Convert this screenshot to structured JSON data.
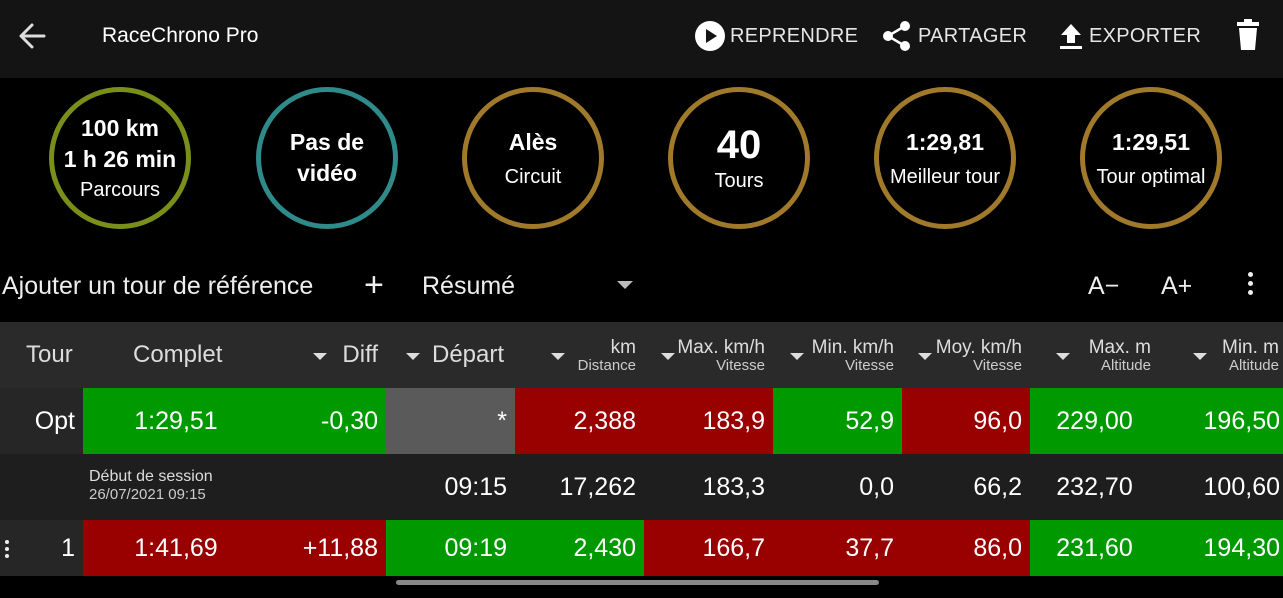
{
  "app_title": "RaceChrono Pro",
  "toolbar": {
    "resume_label": "REPRENDRE",
    "share_label": "PARTAGER",
    "export_label": "EXPORTER"
  },
  "stats": [
    {
      "value": "100 km\n1 h 26 min",
      "label": "Parcours",
      "color": "#7a8f1a"
    },
    {
      "value": "Pas de\nvidéo",
      "label": "",
      "color": "#2f8a8a"
    },
    {
      "value": "Alès",
      "label": "Circuit",
      "color": "#a07a2a"
    },
    {
      "value": "40",
      "label": "Tours",
      "color": "#a07a2a"
    },
    {
      "value": "1:29,81",
      "label": "Meilleur tour",
      "color": "#a07a2a"
    },
    {
      "value": "1:29,51",
      "label": "Tour optimal",
      "color": "#a07a2a"
    }
  ],
  "controls": {
    "add_reference_label": "Ajouter un tour de référence",
    "add_icon": "+",
    "view_select": "Résumé",
    "font_decrease": "A−",
    "font_increase": "A+"
  },
  "table": {
    "headers": {
      "tour": "Tour",
      "complet": "Complet",
      "diff": "Diff",
      "depart": "Départ",
      "km": {
        "title": "km",
        "sub": "Distance"
      },
      "maxkmh": {
        "title": "Max. km/h",
        "sub": "Vitesse"
      },
      "minkmh": {
        "title": "Min. km/h",
        "sub": "Vitesse"
      },
      "moykmh": {
        "title": "Moy. km/h",
        "sub": "Vitesse"
      },
      "maxm": {
        "title": "Max. m",
        "sub": "Altitude"
      },
      "minm": {
        "title": "Min. m",
        "sub": "Altitude"
      }
    },
    "opt_row": {
      "tour": "Opt",
      "complet": "1:29,51",
      "diff": "-0,30",
      "depart": "*",
      "km": "2,388",
      "maxkmh": "183,9",
      "minkmh": "52,9",
      "moykmh": "96,0",
      "maxm": "229,00",
      "minm": "196,50"
    },
    "session_row": {
      "title": "Début de session",
      "datetime": "26/07/2021 09:15",
      "depart": "09:15",
      "km": "17,262",
      "maxkmh": "183,3",
      "minkmh": "0,0",
      "moykmh": "66,2",
      "maxm": "232,70",
      "minm": "100,60"
    },
    "lap1_row": {
      "tour": "1",
      "complet": "1:41,69",
      "diff": "+11,88",
      "depart": "09:19",
      "km": "2,430",
      "maxkmh": "166,7",
      "minkmh": "37,7",
      "moykmh": "86,0",
      "maxm": "231,60",
      "minm": "194,30"
    }
  },
  "colors": {
    "good": "#009a00",
    "bad": "#990000",
    "neutral": "#5a5a5a"
  }
}
